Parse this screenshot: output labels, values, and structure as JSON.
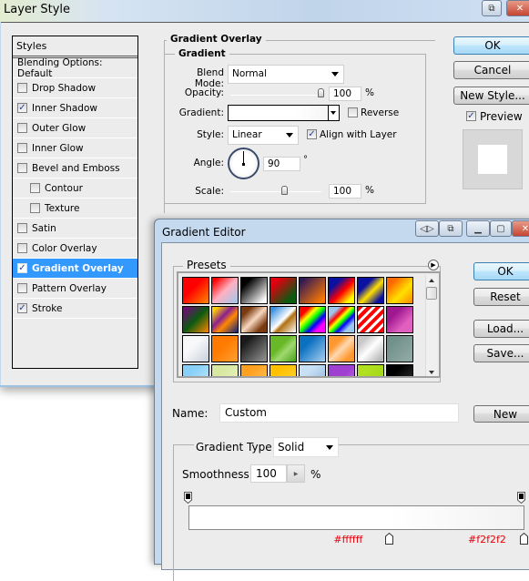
{
  "layer_style": {
    "title": "Layer Style",
    "styles_header": "Styles",
    "items": [
      {
        "label": "Blending Options: Default",
        "checkbox": false,
        "checked": false,
        "indent": false,
        "selected": false
      },
      {
        "label": "Drop Shadow",
        "checkbox": true,
        "checked": false,
        "indent": false,
        "selected": false
      },
      {
        "label": "Inner Shadow",
        "checkbox": true,
        "checked": true,
        "indent": false,
        "selected": false
      },
      {
        "label": "Outer Glow",
        "checkbox": true,
        "checked": false,
        "indent": false,
        "selected": false
      },
      {
        "label": "Inner Glow",
        "checkbox": true,
        "checked": false,
        "indent": false,
        "selected": false
      },
      {
        "label": "Bevel and Emboss",
        "checkbox": true,
        "checked": false,
        "indent": false,
        "selected": false
      },
      {
        "label": "Contour",
        "checkbox": true,
        "checked": false,
        "indent": true,
        "selected": false
      },
      {
        "label": "Texture",
        "checkbox": true,
        "checked": false,
        "indent": true,
        "selected": false
      },
      {
        "label": "Satin",
        "checkbox": true,
        "checked": false,
        "indent": false,
        "selected": false
      },
      {
        "label": "Color Overlay",
        "checkbox": true,
        "checked": false,
        "indent": false,
        "selected": false
      },
      {
        "label": "Gradient Overlay",
        "checkbox": true,
        "checked": true,
        "indent": false,
        "selected": true
      },
      {
        "label": "Pattern Overlay",
        "checkbox": true,
        "checked": false,
        "indent": false,
        "selected": false
      },
      {
        "label": "Stroke",
        "checkbox": true,
        "checked": true,
        "indent": false,
        "selected": false
      }
    ],
    "gradient_overlay": {
      "section_title": "Gradient Overlay",
      "group_title": "Gradient",
      "blend_mode_label": "Blend Mode:",
      "blend_mode_value": "Normal",
      "opacity_label": "Opacity:",
      "opacity_value": "100",
      "opacity_unit": "%",
      "opacity_fraction": 1.0,
      "gradient_label": "Gradient:",
      "reverse_label": "Reverse",
      "reverse_checked": false,
      "style_label": "Style:",
      "style_value": "Linear",
      "align_label": "Align with Layer",
      "align_checked": true,
      "angle_label": "Angle:",
      "angle_value": "90",
      "angle_unit": "°",
      "scale_label": "Scale:",
      "scale_value": "100",
      "scale_unit": "%",
      "scale_fraction": 0.5
    },
    "buttons": {
      "ok": "OK",
      "cancel": "Cancel",
      "new_style": "New Style...",
      "preview_label": "Preview",
      "preview_checked": true
    }
  },
  "gradient_editor": {
    "title": "Gradient Editor",
    "presets_label": "Presets",
    "buttons": {
      "ok": "OK",
      "reset": "Reset",
      "load": "Load...",
      "save": "Save...",
      "new": "New"
    },
    "name_label": "Name:",
    "name_value": "Custom",
    "gradient_type_label": "Gradient Type:",
    "gradient_type_value": "Solid",
    "smoothness_label": "Smoothness:",
    "smoothness_value": "100",
    "smoothness_unit": "%",
    "color_stops": [
      {
        "annotation": "#ffffff",
        "position": 0.6
      },
      {
        "annotation": "#f2f2f2",
        "position": 1.0
      }
    ],
    "gradient_colors": [
      "#ffffff",
      "#f2f2f2"
    ],
    "presets": [
      "linear-gradient(135deg,#ff0000 40%,#ff8800 100%)",
      "linear-gradient(135deg,#ff0000 10%,#ffb0c0 50%,#9cc8ee 100%)",
      "linear-gradient(135deg,#000 20%,#fff 90%)",
      "linear-gradient(135deg,#e00010 20%,#0a5a10 80%)",
      "linear-gradient(135deg,#301858 10%,#ff7a00 90%)",
      "linear-gradient(135deg,#0a10a0 25%,#ff0000 55%,#ffff00 85%)",
      "linear-gradient(135deg,#0a10a0 30%,#ffe000 55%,#0a10a0 85%)",
      "linear-gradient(135deg,#ff6a00 20%,#ffe000 60%,#ff8800 100%)",
      "linear-gradient(135deg,#6a1070 10%,#0a5a10 50%,#ff8800 100%)",
      "linear-gradient(135deg,#ffd000 10%,#8a2090 40%,#ff8800 60%,#102080 100%)",
      "linear-gradient(135deg,#7a3a10 20%,#f8d8c0 50%,#7a3a10 80%)",
      "linear-gradient(135deg,#3a90e0 10%,#fff 50%,#b07010 60%,#fff 100%)",
      "linear-gradient(135deg,#ff0000 20%,#ffff00 35%,#00ff00 50%,#0000ff 65%,#ff00ff 80%)",
      "linear-gradient(135deg,#9cc8ee 20%,#ff0000 35%,#ffff00 45%,#00ff00 55%,#0000ff 65%,#9cc8ee 80%)",
      "repeating-linear-gradient(135deg,#ff0000 0 4px,#ffffff 4px 7px)",
      "linear-gradient(135deg,#a01890 30%,#e060c0 70%)",
      "linear-gradient(135deg,#f8f8fa 40%,#c8d0da 100%)",
      "linear-gradient(135deg,#ff7a00 40%,#ffa030 100%)",
      "linear-gradient(135deg,#1a1a1a 20%,#888 90%)",
      "linear-gradient(135deg,#68b828 40%,#a0d870 60%,#48a018 100%)",
      "linear-gradient(135deg,#0a70c0 30%,#a8d0f0 100%)",
      "linear-gradient(135deg,#ff9830 30%,#ffd8b0 50%,#ff9830 80%)",
      "linear-gradient(135deg,#c8c8c8 20%,#ffffff 50%,#b8b8b8 90%)",
      "linear-gradient(135deg,#70908a 20%,#90a8a4 90%)",
      "linear-gradient(135deg,#88d0f8 30%,#c8ecfc 100%)",
      "linear-gradient(135deg,#d8e8a0 30%,#f0f4c8 100%)",
      "linear-gradient(135deg,#ffa020 30%,#ffc860 100%)",
      "linear-gradient(135deg,#ffc000 30%,#ffd848 100%)",
      "linear-gradient(135deg,#c8e0f4 30%,#88b0d8 100%)",
      "linear-gradient(135deg,#a040d0 50%,#c880e8 100%)",
      "linear-gradient(135deg,#b0e020 30%,#98d010 100%)",
      "linear-gradient(135deg,#000 30%,#403838 100%)"
    ]
  }
}
